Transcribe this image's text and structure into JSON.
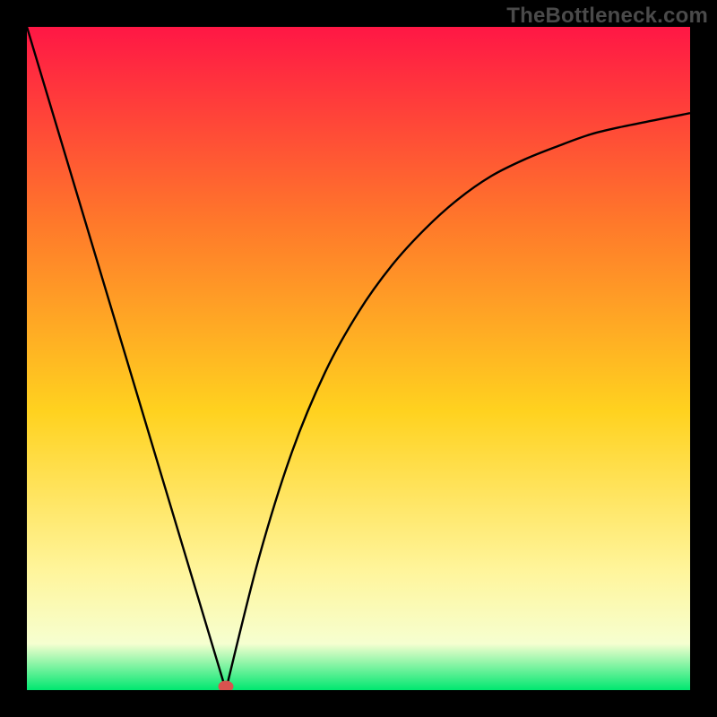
{
  "watermark": "TheBottleneck.com",
  "colors": {
    "frame": "#000000",
    "watermark_text": "#4a4a4a",
    "curve": "#000000",
    "marker_fill": "#d9534f",
    "gradient_top": "#ff1745",
    "gradient_mid_upper": "#ff7a2a",
    "gradient_mid": "#ffd21f",
    "gradient_lower": "#fff59b",
    "gradient_bottom_band": "#f6ffd0",
    "gradient_bottom": "#00e770"
  },
  "chart_data": {
    "type": "line",
    "title": "",
    "xlabel": "",
    "ylabel": "",
    "xlim": [
      0,
      100
    ],
    "ylim": [
      0,
      100
    ],
    "marker": {
      "x": 30,
      "y": 0
    },
    "left_branch": {
      "x": [
        0,
        30
      ],
      "y": [
        100,
        0
      ]
    },
    "right_branch": {
      "x": [
        30,
        35,
        40,
        45,
        50,
        55,
        60,
        65,
        70,
        75,
        80,
        85,
        90,
        95,
        100
      ],
      "y": [
        0,
        20,
        36,
        48,
        57,
        64,
        69.5,
        74,
        77.5,
        80,
        82,
        83.8,
        85,
        86,
        87
      ]
    },
    "description": "V-shaped bottleneck curve with minimum at x≈30; steep linear rise to the left and asymptotic rise to the right; a red marker at the minimum."
  }
}
